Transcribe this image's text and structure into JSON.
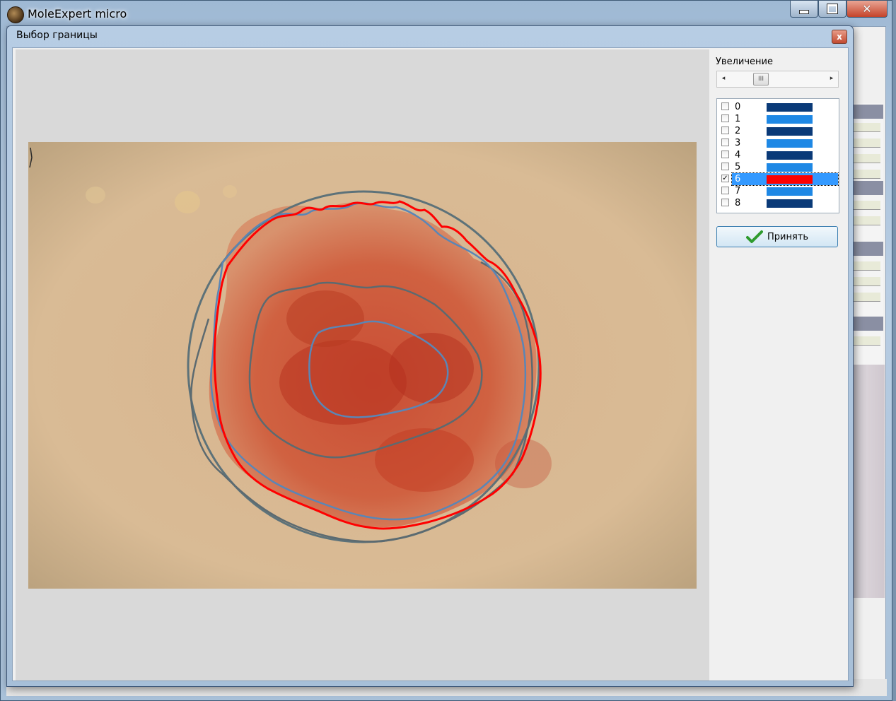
{
  "app": {
    "title": "MoleExpert micro"
  },
  "dialog": {
    "title": "Выбор границы",
    "close_glyph": "x"
  },
  "zoom": {
    "label": "Увеличение",
    "left_arrow": "◂",
    "right_arrow": "▸",
    "thumb_glyph": "III"
  },
  "levels": [
    {
      "label": "0",
      "color": "#0a3a78",
      "checked": false
    },
    {
      "label": "1",
      "color": "#1e88e5",
      "checked": false
    },
    {
      "label": "2",
      "color": "#0a3a78",
      "checked": false
    },
    {
      "label": "3",
      "color": "#1e88e5",
      "checked": false
    },
    {
      "label": "4",
      "color": "#0a3a78",
      "checked": false
    },
    {
      "label": "5",
      "color": "#1e88e5",
      "checked": false
    },
    {
      "label": "6",
      "color": "#ff0000",
      "checked": true
    },
    {
      "label": "7",
      "color": "#1e88e5",
      "checked": false
    },
    {
      "label": "8",
      "color": "#0a3a78",
      "checked": false
    }
  ],
  "accept_button": {
    "label": "Принять",
    "icon": "checkmark-icon"
  },
  "colors": {
    "selected_border": "#ff0000",
    "circle_outline": "#5d7279",
    "contour_blue": "#5a86b6",
    "contour_gray": "#5c6a70",
    "skin": "#d6b591",
    "lesion": "#c9402a",
    "selection_highlight": "#3399ff"
  }
}
